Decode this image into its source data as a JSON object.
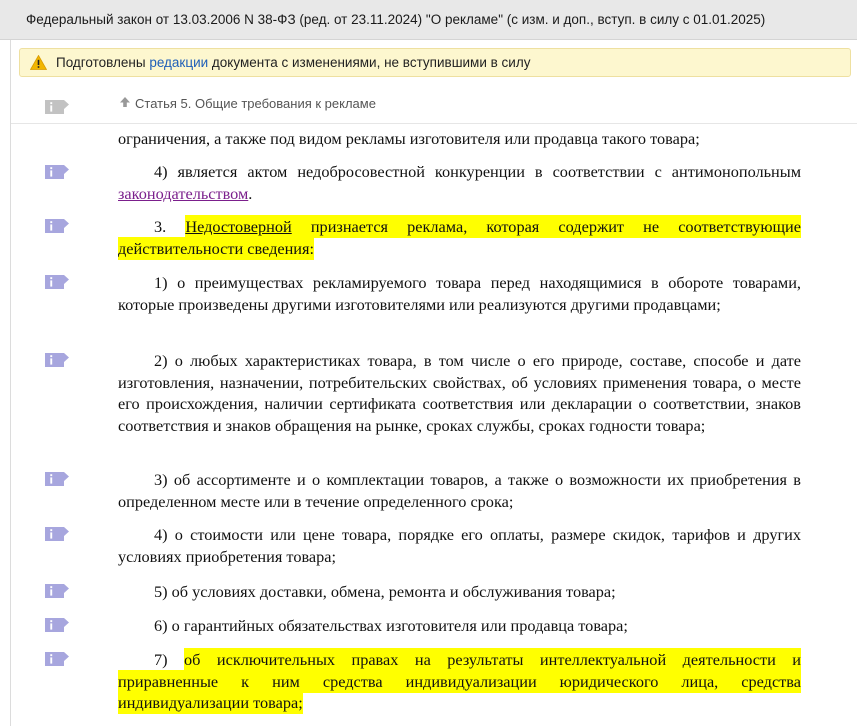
{
  "header": {
    "title": "Федеральный закон от 13.03.2006 N 38-ФЗ (ред. от 23.11.2024) \"О рекламе\" (с изм. и доп., вступ. в силу с 01.01.2025)"
  },
  "warning": {
    "prefix": "Подготовлены ",
    "link": "редакции",
    "suffix": " документа с изменениями, не вступившими в силу"
  },
  "breadcrumb": {
    "label": "Статья 5. Общие требования к рекламе"
  },
  "colors": {
    "highlight": "#ffff00",
    "link_visited": "#7b1f8c",
    "info_icon": "#a7a6de",
    "info_icon_inactive": "#c2c2c2"
  },
  "icons": {
    "info": "info-comment-icon",
    "warning": "warning-triangle-icon",
    "up": "arrow-up-icon"
  },
  "paragraphs": [
    {
      "text": "ограничения, а также под видом рекламы изготовителя или продавца такого товара;"
    },
    {
      "before": "4) является актом недобросовестной конкуренции в соответствии с антимонопольным ",
      "link": "законодательством",
      "after": "."
    },
    {
      "before": "3. ",
      "highlight_link": "Недостоверной",
      "highlight": " признается реклама, которая содержит не соответствующие действительности сведения:"
    },
    {
      "text": "1) о преимуществах рекламируемого товара перед находящимися в обороте товарами, которые произведены другими изготовителями или реализуются другими продавцами;"
    },
    {
      "text": "2) о любых характеристиках товара, в том числе о его природе, составе, способе и дате изготовления, назначении, потребительских свойствах, об условиях применения товара, о месте его происхождения, наличии сертификата соответствия или декларации о соответствии, знаков соответствия и знаков обращения на рынке, сроках службы, сроках годности товара;"
    },
    {
      "text": "3) об ассортименте и о комплектации товаров, а также о возможности их приобретения в определенном месте или в течение определенного срока;"
    },
    {
      "text": "4) о стоимости или цене товара, порядке его оплаты, размере скидок, тарифов и других условиях приобретения товара;"
    },
    {
      "text": "5) об условиях доставки, обмена, ремонта и обслуживания товара;"
    },
    {
      "text": "6) о гарантийных обязательствах изготовителя или продавца товара;"
    },
    {
      "before": "7) ",
      "highlight": "об исключительных правах на результаты интеллектуальной деятельности и приравненные к ним средства индивидуализации юридического лица, средства индивидуализации товара;"
    }
  ]
}
